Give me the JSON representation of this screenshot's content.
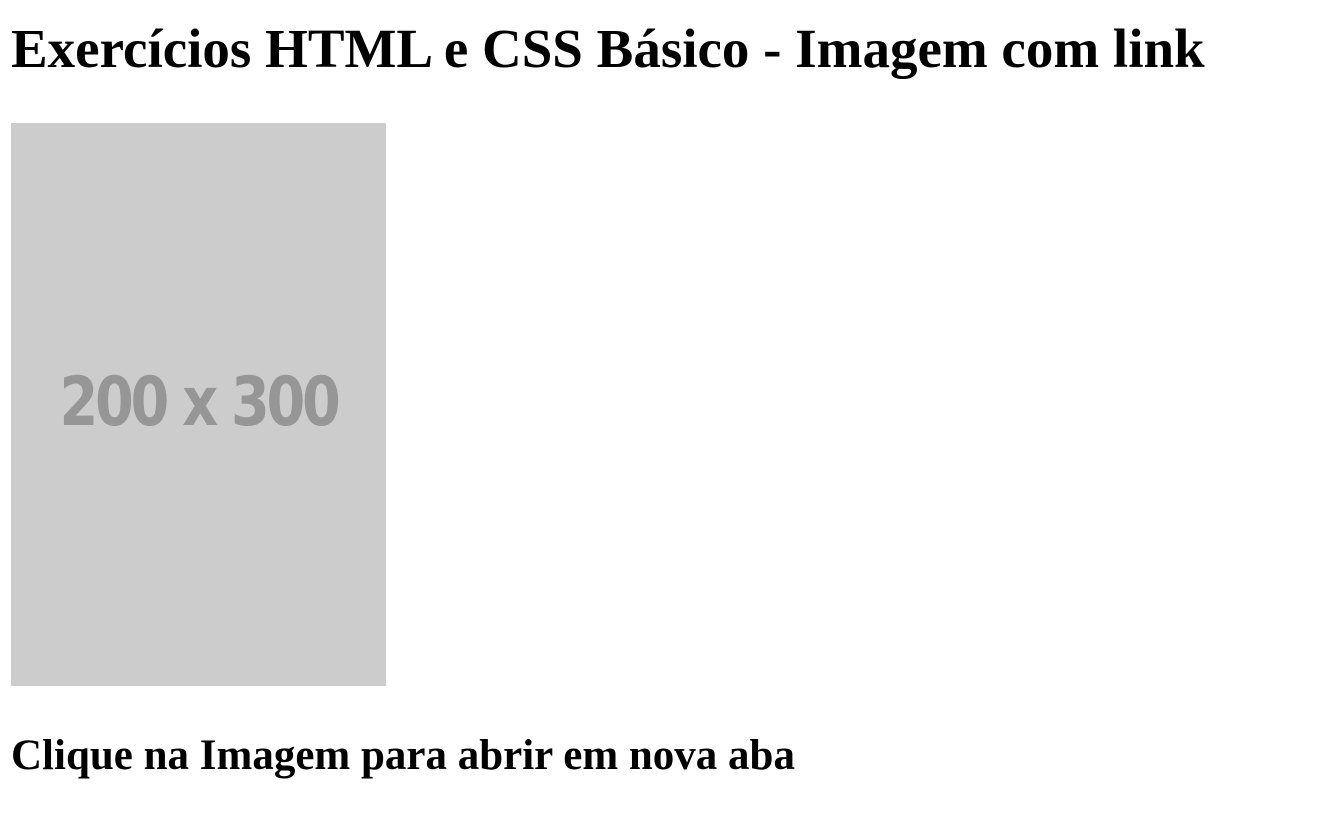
{
  "page": {
    "title": "Exercícios HTML e CSS Básico - Imagem com link",
    "caption": "Clique na Imagem para abrir em nova aba"
  },
  "image": {
    "placeholder_text": "200 x 300",
    "background_color": "#cccccc",
    "text_color": "#969696"
  }
}
